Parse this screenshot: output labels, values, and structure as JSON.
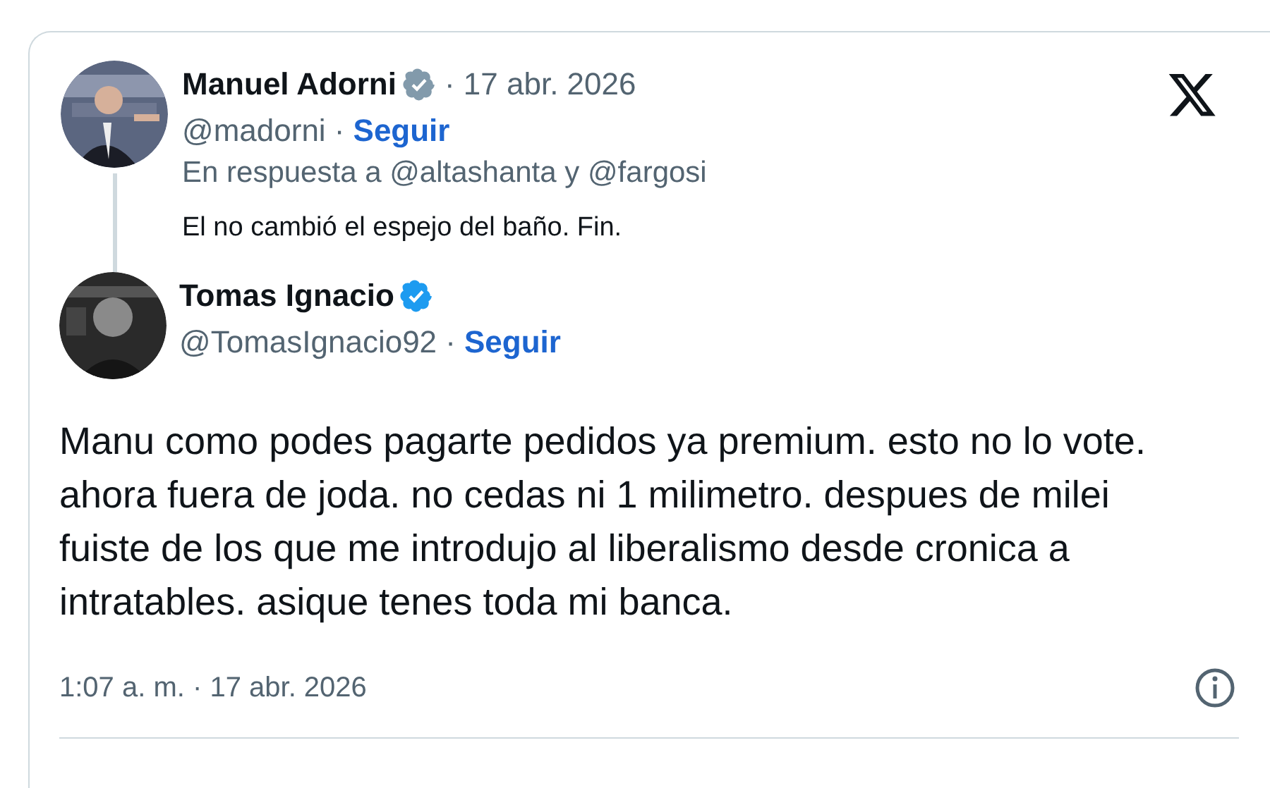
{
  "logo": {
    "kind": "x"
  },
  "parent_post": {
    "name": "Manuel Adorni",
    "verified": true,
    "date": "· 17 abr. 2026",
    "handle": "@madorni ·",
    "follow": "Seguir",
    "reply_to": "En respuesta a @altashanta y @fargosi",
    "text": "El no cambió el espejo del baño. Fin."
  },
  "post": {
    "name": "Tomas Ignacio",
    "verified": true,
    "handle": "@TomasIgnacio92 ·",
    "follow": "Seguir",
    "text": [
      "Manu como podes pagarte pedidos ya premium. esto no lo vote.",
      "ahora fuera de joda. no cedas ni 1 milimetro. despues de milei fuiste de los que me introdujo al liberalismo desde cronica a intratables. asique tenes toda mi banca."
    ],
    "timestamp": "1:07 a. m. · 17 abr. 2026"
  }
}
